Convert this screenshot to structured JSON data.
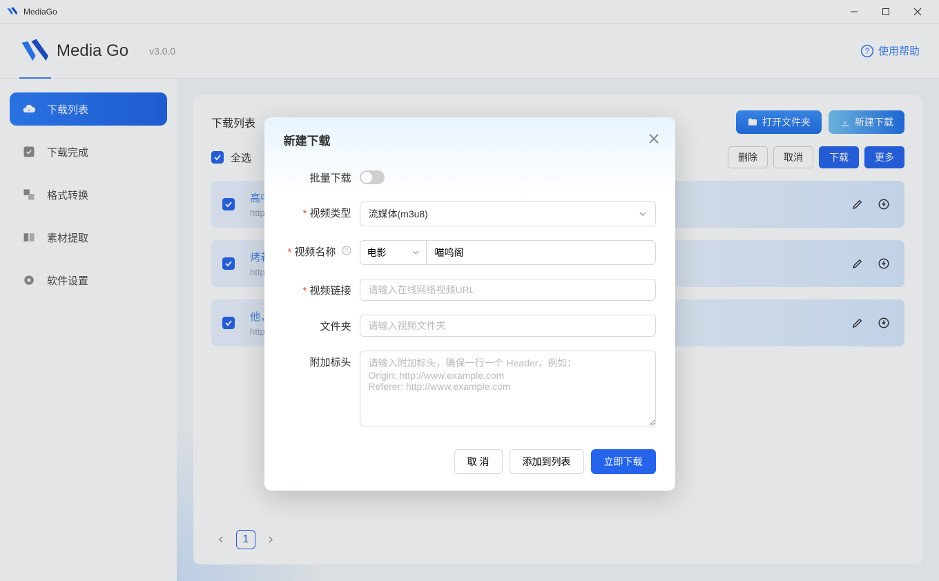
{
  "window": {
    "title": "MediaGo"
  },
  "header": {
    "app_name": "Media Go",
    "version": "v3.0.0",
    "help": "使用帮助"
  },
  "sidebar": [
    {
      "label": "下载列表",
      "active": true
    },
    {
      "label": "下载完成"
    },
    {
      "label": "格式转换"
    },
    {
      "label": "素材提取"
    },
    {
      "label": "软件设置"
    }
  ],
  "main": {
    "title": "下载列表",
    "open_folder": "打开文件夹",
    "new_download": "新建下载",
    "select_all": "全选",
    "delete": "删除",
    "cancel": "取消",
    "download": "下载",
    "more": "更多"
  },
  "items": [
    {
      "title": "高中",
      "url": "https"
    },
    {
      "title": "烤着",
      "url": "https"
    },
    {
      "title": "他，",
      "url": "https"
    }
  ],
  "pagination": {
    "current": "1"
  },
  "dialog": {
    "title": "新建下载",
    "batch_label": "批量下载",
    "video_type_label": "视频类型",
    "video_type_value": "流媒体(m3u8)",
    "video_name_label": "视频名称",
    "name_prefix": "电影",
    "name_value": "喵呜阁",
    "video_link_label": "视频链接",
    "video_link_placeholder": "请输入在线网络视频URL",
    "folder_label": "文件夹",
    "folder_placeholder": "请输入视频文件夹",
    "headers_label": "附加标头",
    "headers_placeholder": "请输入附加标头，确保一行一个 Header，例如：\nOrigin: http://www.example.com\nReferer: http://www.example.com",
    "cancel": "取 消",
    "add_to_list": "添加到列表",
    "download_now": "立即下载"
  }
}
